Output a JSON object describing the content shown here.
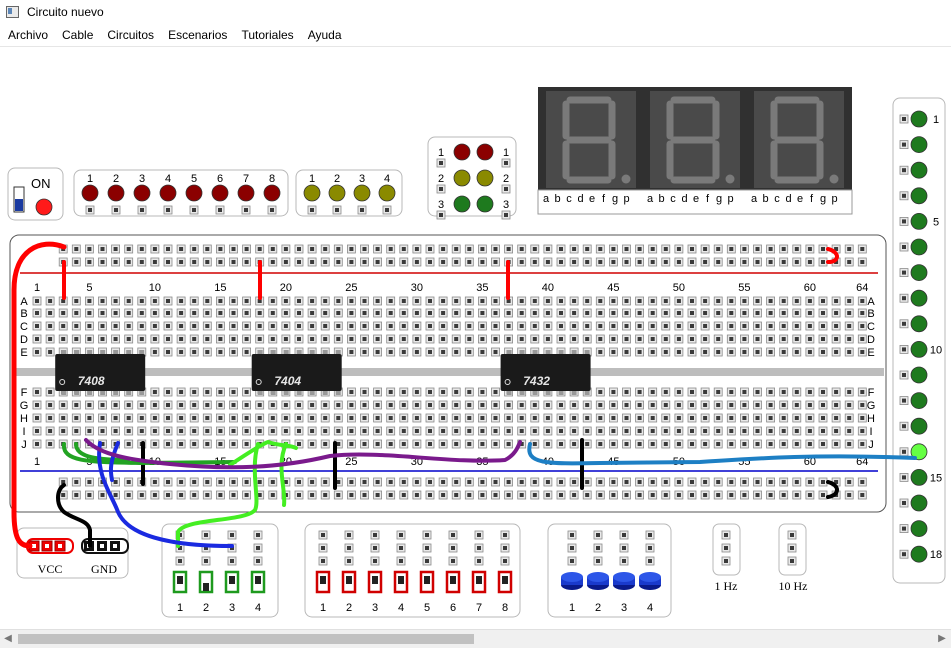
{
  "window": {
    "title": "Circuito nuevo"
  },
  "menu": [
    "Archivo",
    "Cable",
    "Circuitos",
    "Escenarios",
    "Tutoriales",
    "Ayuda"
  ],
  "switch_panel": {
    "label": "ON"
  },
  "red_leds": [
    "1",
    "2",
    "3",
    "4",
    "5",
    "6",
    "7",
    "8"
  ],
  "yellow_leds": [
    "1",
    "2",
    "3",
    "4"
  ],
  "traffic_light": {
    "rows": [
      "1",
      "2",
      "3"
    ]
  },
  "seven_segment": {
    "segment_labels": [
      "a",
      "b",
      "c",
      "d",
      "e",
      "f",
      "g",
      "p"
    ],
    "count": 3
  },
  "breadboard": {
    "column_numbers": [
      "1",
      "5",
      "10",
      "15",
      "20",
      "25",
      "30",
      "35",
      "40",
      "45",
      "50",
      "55",
      "60",
      "64"
    ],
    "top_rows": [
      "A",
      "B",
      "C",
      "D",
      "E"
    ],
    "bottom_rows": [
      "F",
      "G",
      "H",
      "I",
      "J"
    ]
  },
  "chips": [
    {
      "label": "7408"
    },
    {
      "label": "7404"
    },
    {
      "label": "7432"
    }
  ],
  "power": {
    "vcc": "VCC",
    "gnd": "GND"
  },
  "green_switches": [
    "1",
    "2",
    "3",
    "4"
  ],
  "red_switches": [
    "1",
    "2",
    "3",
    "4",
    "5",
    "6",
    "7",
    "8"
  ],
  "pushbuttons": [
    "1",
    "2",
    "3",
    "4"
  ],
  "clocks": [
    "1 Hz",
    "10 Hz"
  ],
  "right_leds": {
    "labels": {
      "0": "1",
      "4": "5",
      "9": "10",
      "14": "15",
      "17": "18"
    },
    "lit_index": 13
  },
  "colors": {
    "wire_red": "#ff0000",
    "wire_black": "#000000",
    "wire_green": "#22c322",
    "wire_lightgreen": "#44ee22",
    "wire_blue": "#1a2ae0",
    "wire_purple": "#7a1a8c",
    "wire_cyan": "#1d7fc4",
    "rail_red": "#d00000",
    "rail_blue": "#0000cc",
    "led_red": "#8b0000",
    "led_yellow": "#8a8a00",
    "led_green": "#1e7a1e",
    "chip": "#1a1a1a",
    "display_bg": "#303030",
    "segment_off": "#7a7a7a"
  }
}
